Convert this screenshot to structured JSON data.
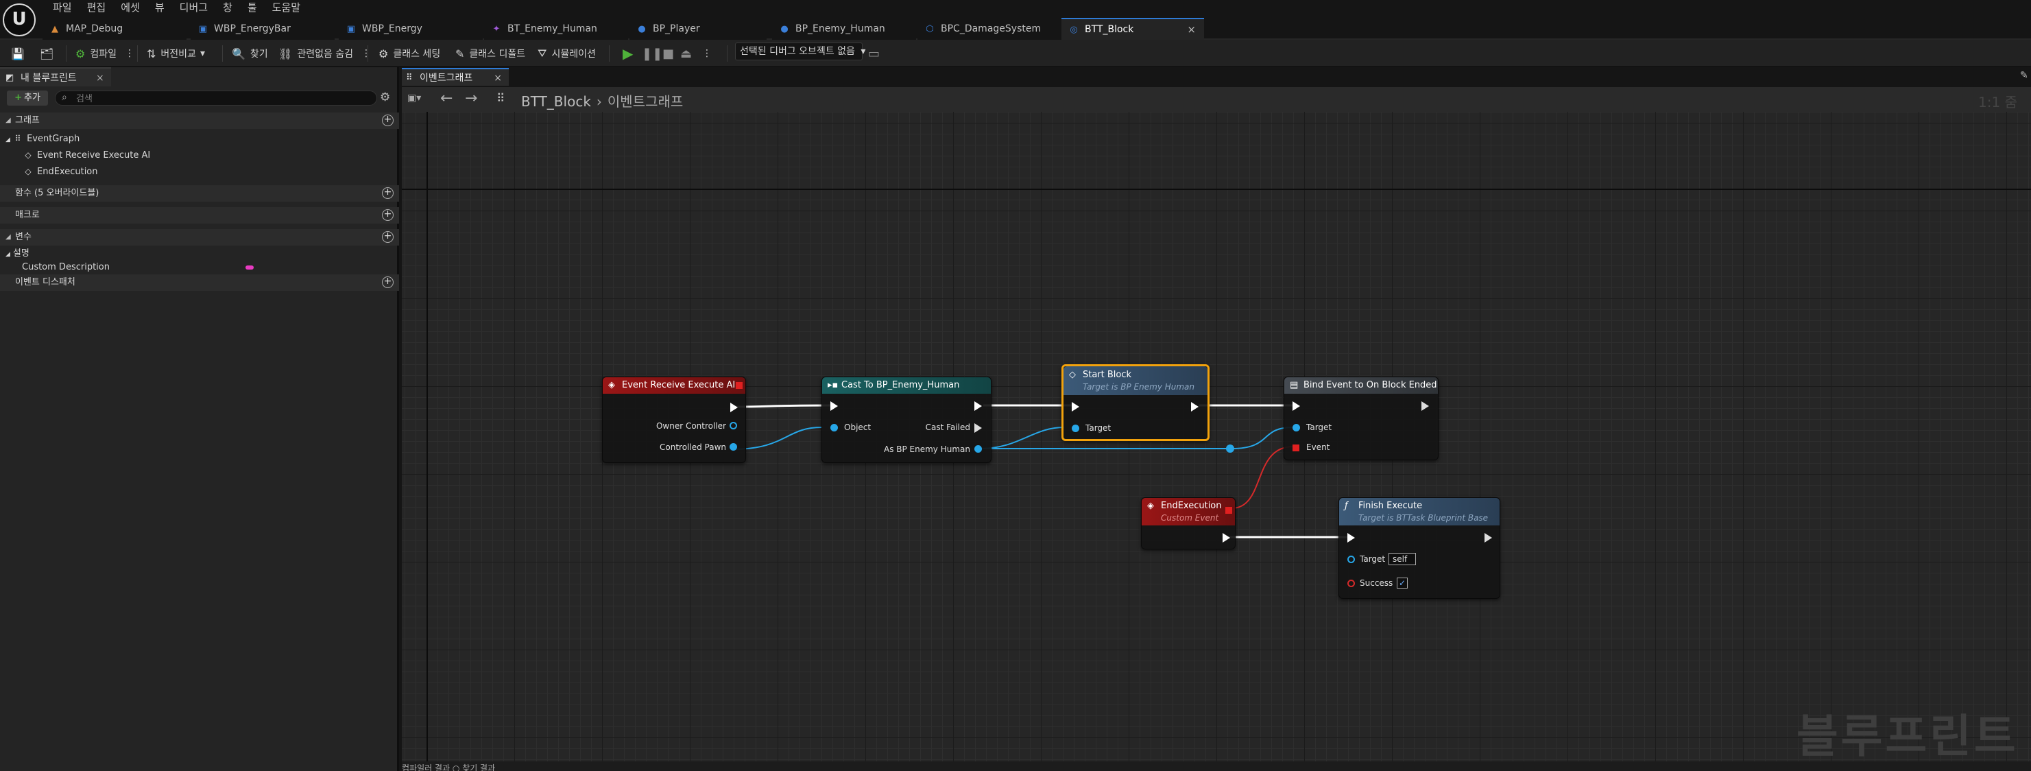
{
  "app": {
    "logo_text": "U"
  },
  "menu": [
    "파일",
    "편집",
    "에셋",
    "뷰",
    "디버그",
    "창",
    "툴",
    "도움말"
  ],
  "doc_tabs": [
    {
      "label": "MAP_Debug",
      "icon": "▲",
      "icon_name": "level-icon",
      "color": "#d98a3a",
      "active": false
    },
    {
      "label": "WBP_EnergyBar",
      "icon": "▣",
      "icon_name": "widget-blueprint-icon",
      "color": "#3b7fd9",
      "active": false
    },
    {
      "label": "WBP_Energy",
      "icon": "▣",
      "icon_name": "widget-blueprint-icon",
      "color": "#3b7fd9",
      "active": false
    },
    {
      "label": "BT_Enemy_Human",
      "icon": "✦",
      "icon_name": "behavior-tree-icon",
      "color": "#a05ad9",
      "active": false
    },
    {
      "label": "BP_Player",
      "icon": "●",
      "icon_name": "character-blueprint-icon",
      "color": "#3b7fd9",
      "active": false
    },
    {
      "label": "BP_Enemy_Human",
      "icon": "●",
      "icon_name": "character-blueprint-icon",
      "color": "#3b7fd9",
      "active": false
    },
    {
      "label": "BPC_DamageSystem",
      "icon": "⬡",
      "icon_name": "component-blueprint-icon",
      "color": "#3b7fd9",
      "active": false
    },
    {
      "label": "BTT_Block",
      "icon": "◎",
      "icon_name": "task-blueprint-icon",
      "color": "#3b7fd9",
      "active": true
    }
  ],
  "toolbar": {
    "compile": "컴파일",
    "diff": "버전비교",
    "find": "찾기",
    "hide_unrelated": "관련없음 숨김",
    "class_settings": "클래스 세팅",
    "class_defaults": "클래스 디폴트",
    "simulation": "시뮬레이션",
    "debug_object": "선택된 디버그 오브젝트 없음"
  },
  "left_panel": {
    "tab": "내 블루프린트",
    "add": "추가",
    "search_placeholder": "검색",
    "sections": {
      "graphs": "그래프",
      "functions": "함수 (5 오버라이드블)",
      "macros": "매크로",
      "variables": "변수",
      "event_dispatchers": "이벤트 디스패처"
    },
    "event_graph": "EventGraph",
    "event_items": [
      "Event Receive Execute AI",
      "EndExecution"
    ],
    "var_category": "설명",
    "variable": "Custom Description"
  },
  "graph": {
    "tab": "이벤트그래프",
    "breadcrumb_root": "BTT_Block",
    "breadcrumb_current": "이벤트그래프",
    "zoom": "1:1 줌",
    "watermark": "블루프린트",
    "bottom_label": "컴파일러 결과    ○  찾기 결과"
  },
  "nodes": {
    "event_receive": {
      "title": "Event Receive Execute AI",
      "pins": [
        "Owner Controller",
        "Controlled Pawn"
      ]
    },
    "cast": {
      "title": "Cast To BP_Enemy_Human",
      "pins": [
        "Object",
        "Cast Failed",
        "As BP Enemy Human"
      ]
    },
    "start_block": {
      "title": "Start Block",
      "subtitle": "Target is BP Enemy Human",
      "pins": [
        "Target"
      ]
    },
    "bind_event": {
      "title": "Bind Event to On Block Ended",
      "pins": [
        "Target",
        "Event"
      ]
    },
    "end_execution": {
      "title": "EndExecution",
      "subtitle": "Custom Event"
    },
    "finish_execute": {
      "title": "Finish Execute",
      "subtitle": "Target is BTTask Blueprint Base",
      "pins": [
        "Target",
        "Success"
      ],
      "target_value": "self",
      "success_value": "✓"
    }
  },
  "colors": {
    "exec_wire": "#ffffff",
    "object_wire": "#27a7e8",
    "delegate_wire": "#d42a2a",
    "selected": "#f2a20c",
    "event_header": "#9a1616",
    "cast_header": "#1a6161",
    "function_header": "#3c5a78"
  }
}
